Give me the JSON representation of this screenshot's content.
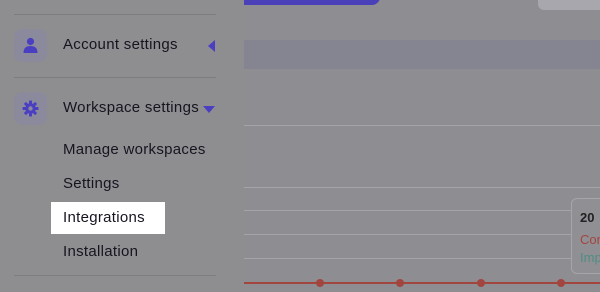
{
  "sidebar": {
    "account": {
      "label": "Account settings",
      "icon": "user-icon"
    },
    "workspace": {
      "label": "Workspace settings",
      "icon": "gear-icon",
      "expanded": true,
      "subitems": [
        {
          "label": "Manage workspaces"
        },
        {
          "label": "Settings"
        },
        {
          "label": "Integrations",
          "active": true
        },
        {
          "label": "Installation"
        }
      ]
    }
  },
  "tooltip": {
    "title": "20",
    "line1": "Con",
    "line2": "Imp"
  },
  "colors": {
    "accent": "#4a3fc0",
    "overlay": "#8e8e91",
    "chart_red": "#a2453f",
    "chart_teal": "#4f8c84"
  }
}
